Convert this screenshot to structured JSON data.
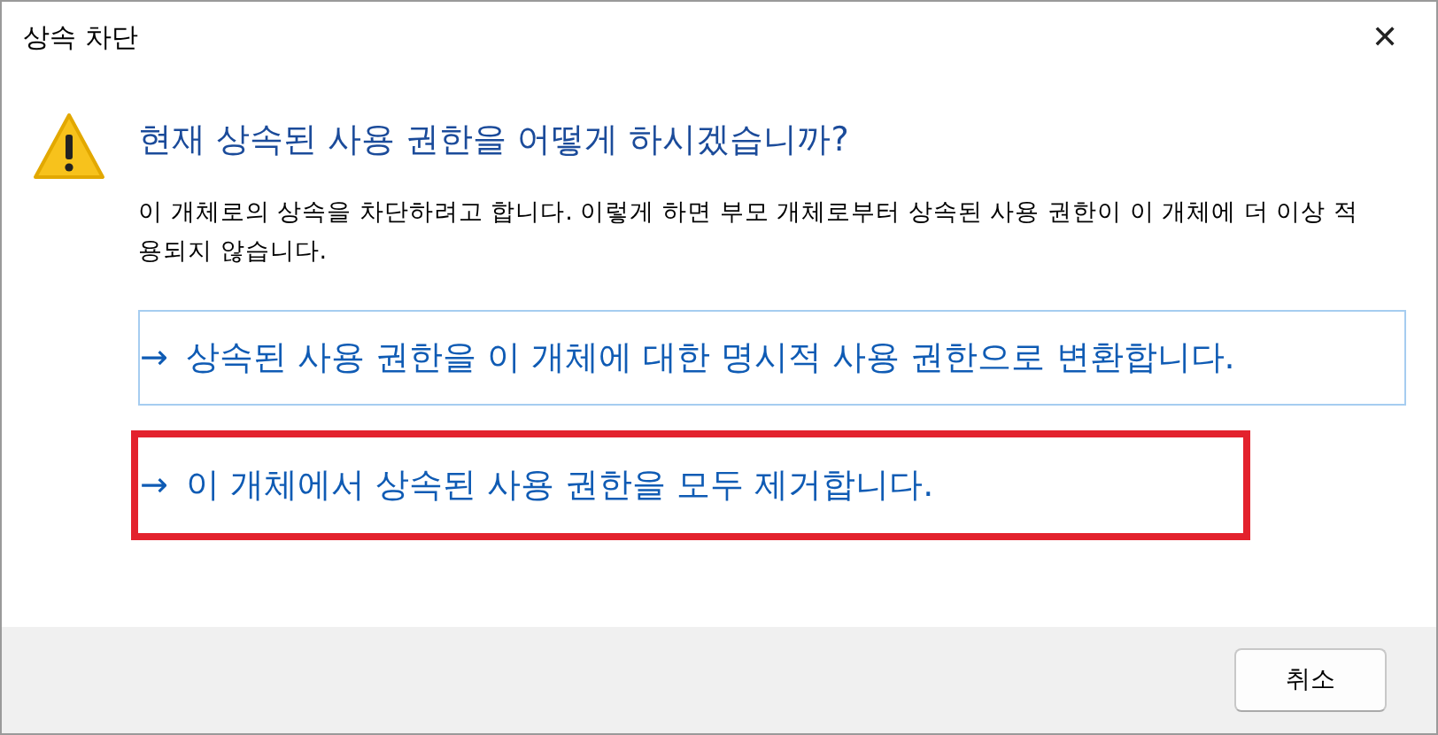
{
  "window": {
    "title": "상속 차단",
    "close": "✕"
  },
  "heading": "현재 상속된 사용 권한을 어떻게 하시겠습니까?",
  "description": "이 개체로의 상속을 차단하려고 합니다. 이렇게 하면 부모 개체로부터 상속된 사용 권한이 이 개체에 더 이상 적용되지 않습니다.",
  "options": [
    {
      "arrow": "→",
      "text": "상속된 사용 권한을 이 개체에 대한 명시적 사용 권한으로 변환합니다.",
      "hovered": true,
      "highlighted": false
    },
    {
      "arrow": "→",
      "text": "이 개체에서 상속된 사용 권한을 모두 제거합니다.",
      "hovered": false,
      "highlighted": true
    }
  ],
  "buttons": [
    "취소"
  ]
}
